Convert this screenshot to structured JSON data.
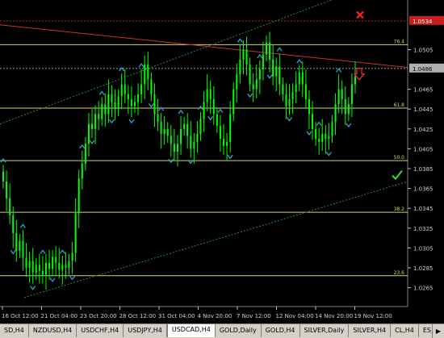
{
  "chart_data": {
    "type": "candlestick",
    "symbol": "USDCAD,H4",
    "ylim": [
      1.025,
      1.0555
    ],
    "price_ticks": [
      "1.0505",
      "1.0465",
      "1.0445",
      "1.0425",
      "1.0405",
      "1.0385",
      "1.0365",
      "1.0345",
      "1.0325",
      "1.0305",
      "1.0285",
      "1.0265"
    ],
    "current_price": "1.0486",
    "stop_price": "1.0534",
    "time_labels": [
      "16 Oct 12:00",
      "21 Oct 04:00",
      "23 Oct 20:00",
      "28 Oct 12:00",
      "31 Oct 04:00",
      "4 Nov 20:00",
      "7 Nov 12:00",
      "12 Nov 04:00",
      "14 Nov 20:00",
      "19 Nov 12:00"
    ],
    "fib_levels": [
      {
        "label": "76.4",
        "price": 1.051
      },
      {
        "label": "61.8",
        "price": 1.0446
      },
      {
        "label": "50.0",
        "price": 1.0393
      },
      {
        "label": "38.2",
        "price": 1.0341
      },
      {
        "label": "23.6",
        "price": 1.0277
      }
    ],
    "closes": [
      1.0372,
      1.0355,
      1.0338,
      1.032,
      1.0302,
      1.0312,
      1.0295,
      1.0285,
      1.0292,
      1.028,
      1.0288,
      1.0282,
      1.0278,
      1.029,
      1.0284,
      1.0296,
      1.029,
      1.0283,
      1.0288,
      1.0285,
      1.0292,
      1.03,
      1.034,
      1.0375,
      1.039,
      1.041,
      1.043,
      1.0425,
      1.044,
      1.0435,
      1.045,
      1.044,
      1.046,
      1.0452,
      1.0445,
      1.0458,
      1.047,
      1.046,
      1.0455,
      1.0448,
      1.0452,
      1.046,
      1.047,
      1.049,
      1.0475,
      1.046,
      1.044,
      1.0432,
      1.042,
      1.0425,
      1.0418,
      1.041,
      1.0402,
      1.041,
      1.0425,
      1.043,
      1.0418,
      1.0405,
      1.0412,
      1.042,
      1.0435,
      1.0452,
      1.0465,
      1.0455,
      1.044,
      1.0428,
      1.0415,
      1.0408,
      1.0412,
      1.044,
      1.0465,
      1.048,
      1.0495,
      1.0505,
      1.049,
      1.047,
      1.0465,
      1.0475,
      1.0485,
      1.05,
      1.0512,
      1.0495,
      1.0478,
      1.0488,
      1.047,
      1.046,
      1.0448,
      1.0455,
      1.0462,
      1.047,
      1.0482,
      1.047,
      1.0455,
      1.044,
      1.0425,
      1.0415,
      1.0412,
      1.042,
      1.0415,
      1.0418,
      1.0432,
      1.045,
      1.0465,
      1.0455,
      1.044,
      1.045,
      1.047,
      1.0478
    ],
    "colors": {
      "background": "#000000",
      "candle": "#00ff00",
      "grid_gold": "#d4d468",
      "trend_red": "#c83232",
      "channel_green": "#2e8b2e",
      "arrow_cyan": "#22b4dc",
      "price_box": "#b0b0b0",
      "stop_box": "#c81e1e"
    }
  },
  "tabs": [
    {
      "label": "SD,H4"
    },
    {
      "label": "NZDUSD,H4"
    },
    {
      "label": "USDCHF,H4"
    },
    {
      "label": "USDJPY,H4"
    },
    {
      "label": "USDCAD,H4",
      "active": true
    },
    {
      "label": "GOLD,Daily"
    },
    {
      "label": "GOLD,H4"
    },
    {
      "label": "SILVER,Daily"
    },
    {
      "label": "SILVER,H4"
    },
    {
      "label": "CL,H4"
    },
    {
      "label": "ES,Week"
    }
  ],
  "tab_scroll_label": "▶"
}
